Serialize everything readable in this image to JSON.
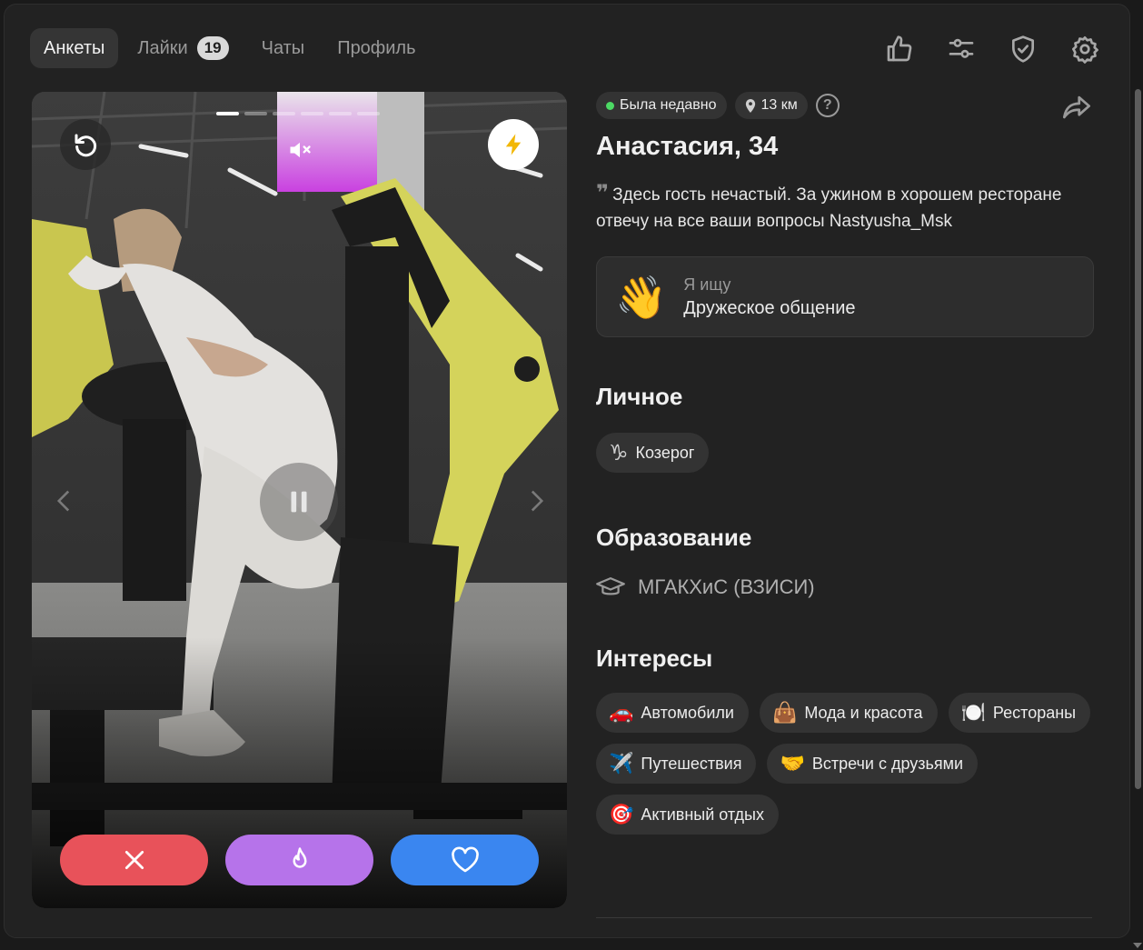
{
  "nav": {
    "tabs": [
      {
        "label": "Анкеты",
        "active": true
      },
      {
        "label": "Лайки",
        "badge": "19"
      },
      {
        "label": "Чаты"
      },
      {
        "label": "Профиль"
      }
    ],
    "icons": [
      "thumbs-up-icon",
      "filters-icon",
      "shield-check-icon",
      "gear-icon"
    ]
  },
  "photo": {
    "slides_total": 6,
    "slide_active": 1,
    "icons": [
      "undo-icon",
      "lightning-icon",
      "mute-icon",
      "pause-icon",
      "close-icon",
      "fire-icon",
      "heart-icon"
    ]
  },
  "profile": {
    "status": "Была недавно",
    "distance": "13 км",
    "help": "?",
    "name": "Анастасия, 34",
    "bio": "Здесь гость нечастый. За ужином в хорошем ресторане отвечу на все ваши вопросы Nastyusha_Msk",
    "looking_for": {
      "emoji": "👋",
      "label": "Я ищу",
      "value": "Дружеское общение"
    },
    "personal": {
      "title": "Личное",
      "tags": [
        {
          "icon": "♑",
          "label": "Козерог"
        }
      ]
    },
    "education": {
      "title": "Образование",
      "value": "МГАКХиС (ВЗИСИ)"
    },
    "interests": {
      "title": "Интересы",
      "tags": [
        {
          "emoji": "🚗",
          "label": "Автомобили"
        },
        {
          "emoji": "👜",
          "label": "Мода и красота"
        },
        {
          "emoji": "🍽️",
          "label": "Рестораны"
        },
        {
          "emoji": "✈️",
          "label": "Путешествия"
        },
        {
          "emoji": "🤝",
          "label": "Встречи с друзьями"
        },
        {
          "emoji": "🎯",
          "label": "Активный отдых"
        }
      ]
    }
  },
  "colors": {
    "dislike": "#e8525a",
    "superlike": "#b673ea",
    "like": "#3a86f0",
    "online": "#4cd964",
    "boost": "#f2b705"
  }
}
